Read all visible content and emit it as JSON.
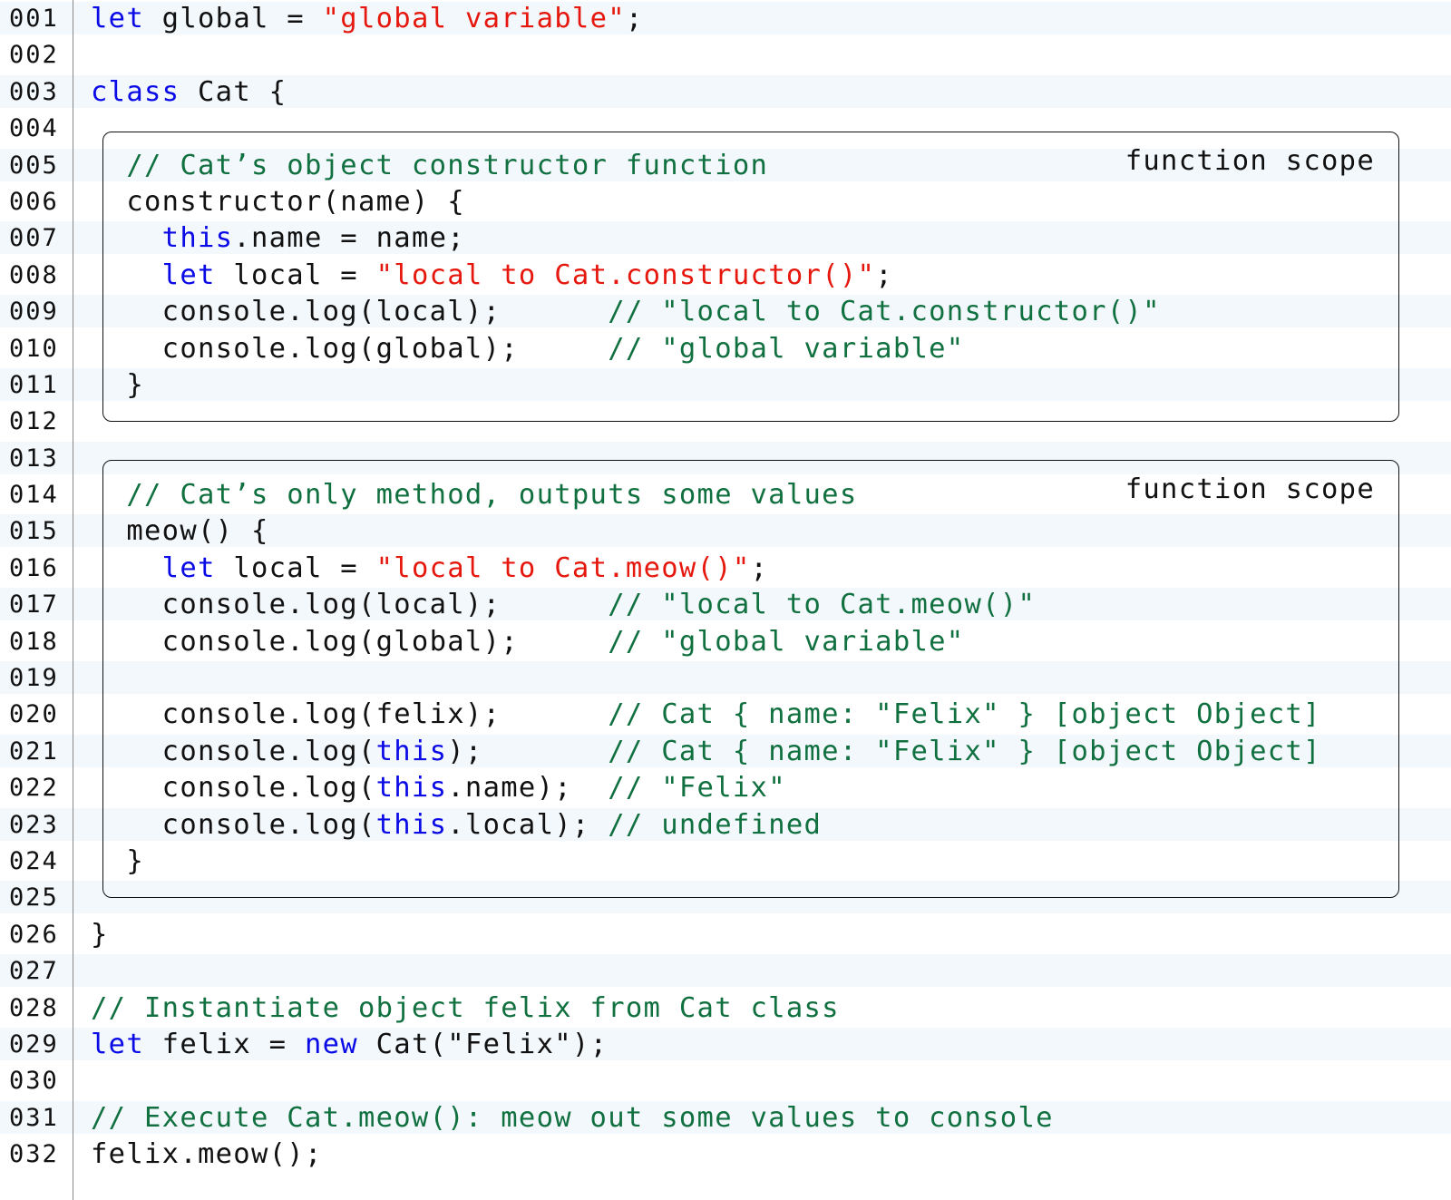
{
  "editor": {
    "lines": [
      {
        "no": "001",
        "tokens": [
          {
            "t": "kw",
            "v": "let"
          },
          {
            "t": "p",
            "v": " global = "
          },
          {
            "t": "str",
            "v": "\"global variable\""
          },
          {
            "t": "p",
            "v": ";"
          }
        ]
      },
      {
        "no": "002",
        "tokens": []
      },
      {
        "no": "003",
        "tokens": [
          {
            "t": "kw",
            "v": "class"
          },
          {
            "t": "p",
            "v": " Cat {"
          }
        ]
      },
      {
        "no": "004",
        "tokens": []
      },
      {
        "no": "005",
        "tokens": [
          {
            "t": "p",
            "v": "  "
          },
          {
            "t": "cm",
            "v": "// Cat’s object constructor function"
          }
        ]
      },
      {
        "no": "006",
        "tokens": [
          {
            "t": "p",
            "v": "  constructor(name) {"
          }
        ]
      },
      {
        "no": "007",
        "tokens": [
          {
            "t": "p",
            "v": "    "
          },
          {
            "t": "kw",
            "v": "this"
          },
          {
            "t": "p",
            "v": ".name = name;"
          }
        ]
      },
      {
        "no": "008",
        "tokens": [
          {
            "t": "p",
            "v": "    "
          },
          {
            "t": "kw",
            "v": "let"
          },
          {
            "t": "p",
            "v": " local = "
          },
          {
            "t": "str",
            "v": "\"local to Cat.constructor()\""
          },
          {
            "t": "p",
            "v": ";"
          }
        ]
      },
      {
        "no": "009",
        "tokens": [
          {
            "t": "p",
            "v": "    console.log(local);      "
          },
          {
            "t": "cm",
            "v": "// \"local to Cat.constructor()\""
          }
        ]
      },
      {
        "no": "010",
        "tokens": [
          {
            "t": "p",
            "v": "    console.log(global);     "
          },
          {
            "t": "cm",
            "v": "// \"global variable\""
          }
        ]
      },
      {
        "no": "011",
        "tokens": [
          {
            "t": "p",
            "v": "  }"
          }
        ]
      },
      {
        "no": "012",
        "tokens": []
      },
      {
        "no": "013",
        "tokens": []
      },
      {
        "no": "014",
        "tokens": [
          {
            "t": "p",
            "v": "  "
          },
          {
            "t": "cm",
            "v": "// Cat’s only method, outputs some values"
          }
        ]
      },
      {
        "no": "015",
        "tokens": [
          {
            "t": "p",
            "v": "  meow() {"
          }
        ]
      },
      {
        "no": "016",
        "tokens": [
          {
            "t": "p",
            "v": "    "
          },
          {
            "t": "kw",
            "v": "let"
          },
          {
            "t": "p",
            "v": " local = "
          },
          {
            "t": "str",
            "v": "\"local to Cat.meow()\""
          },
          {
            "t": "p",
            "v": ";"
          }
        ]
      },
      {
        "no": "017",
        "tokens": [
          {
            "t": "p",
            "v": "    console.log(local);      "
          },
          {
            "t": "cm",
            "v": "// \"local to Cat.meow()\""
          }
        ]
      },
      {
        "no": "018",
        "tokens": [
          {
            "t": "p",
            "v": "    console.log(global);     "
          },
          {
            "t": "cm",
            "v": "// \"global variable\""
          }
        ]
      },
      {
        "no": "019",
        "tokens": []
      },
      {
        "no": "020",
        "tokens": [
          {
            "t": "p",
            "v": "    console.log(felix);      "
          },
          {
            "t": "cm",
            "v": "// Cat { name: \"Felix\" } [object Object]"
          }
        ]
      },
      {
        "no": "021",
        "tokens": [
          {
            "t": "p",
            "v": "    console.log("
          },
          {
            "t": "kw",
            "v": "this"
          },
          {
            "t": "p",
            "v": ");       "
          },
          {
            "t": "cm",
            "v": "// Cat { name: \"Felix\" } [object Object]"
          }
        ]
      },
      {
        "no": "022",
        "tokens": [
          {
            "t": "p",
            "v": "    console.log("
          },
          {
            "t": "kw",
            "v": "this"
          },
          {
            "t": "p",
            "v": ".name);  "
          },
          {
            "t": "cm",
            "v": "// \"Felix\""
          }
        ]
      },
      {
        "no": "023",
        "tokens": [
          {
            "t": "p",
            "v": "    console.log("
          },
          {
            "t": "kw",
            "v": "this"
          },
          {
            "t": "p",
            "v": ".local); "
          },
          {
            "t": "cm",
            "v": "// undefined"
          }
        ]
      },
      {
        "no": "024",
        "tokens": [
          {
            "t": "p",
            "v": "  }"
          }
        ]
      },
      {
        "no": "025",
        "tokens": []
      },
      {
        "no": "026",
        "tokens": [
          {
            "t": "p",
            "v": "}"
          }
        ]
      },
      {
        "no": "027",
        "tokens": []
      },
      {
        "no": "028",
        "tokens": [
          {
            "t": "cm",
            "v": "// Instantiate object felix from Cat class"
          }
        ]
      },
      {
        "no": "029",
        "tokens": [
          {
            "t": "kw",
            "v": "let"
          },
          {
            "t": "p",
            "v": " felix = "
          },
          {
            "t": "kw",
            "v": "new"
          },
          {
            "t": "p",
            "v": " Cat(\"Felix\");"
          }
        ]
      },
      {
        "no": "030",
        "tokens": []
      },
      {
        "no": "031",
        "tokens": [
          {
            "t": "cm",
            "v": "// Execute Cat.meow(): meow out some values to console"
          }
        ]
      },
      {
        "no": "032",
        "tokens": [
          {
            "t": "p",
            "v": "felix.meow();"
          }
        ]
      }
    ]
  },
  "scopes": [
    {
      "label": "function scope",
      "first_line": "004",
      "last_line": "012"
    },
    {
      "label": "function scope",
      "first_line": "013",
      "last_line": "025"
    }
  ],
  "colors": {
    "keyword": "#0a0ae6",
    "string": "#e6180e",
    "comment": "#11703f",
    "text": "#111111",
    "row_tint": "#f3f8fc"
  }
}
